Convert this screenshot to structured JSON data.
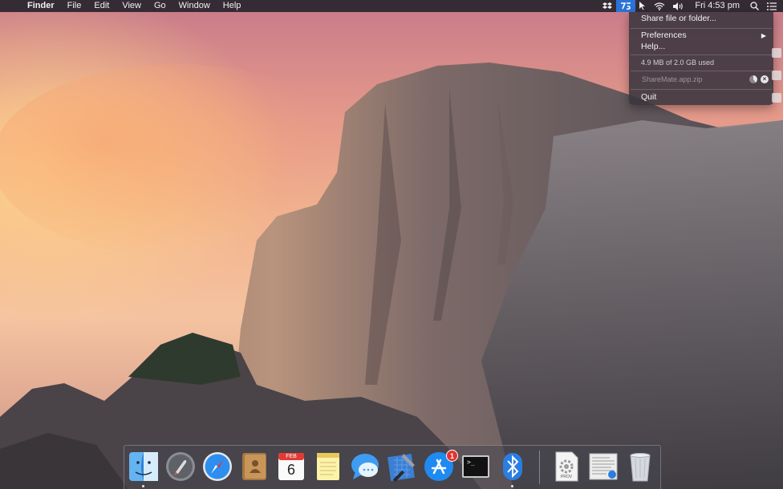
{
  "menubar": {
    "app_name": "Finder",
    "menus": [
      "File",
      "Edit",
      "View",
      "Go",
      "Window",
      "Help"
    ],
    "clock": "Fri 4:53 pm",
    "status_icons": [
      "dropbox-icon",
      "sharemate-icon",
      "cursor-icon",
      "wifi-icon",
      "volume-icon",
      "spotlight-icon",
      "notification-center-icon"
    ],
    "active_status_icon": "sharemate-icon"
  },
  "dropdown": {
    "share_label": "Share file or folder...",
    "preferences_label": "Preferences",
    "help_label": "Help...",
    "usage_text": "4.9 MB of 2.0 GB used",
    "upload_file": "ShareMate.app.zip",
    "quit_label": "Quit"
  },
  "dock": {
    "calendar_month": "FEB",
    "calendar_day": "6",
    "appstore_badge": "1",
    "terminal_prompt": ">_",
    "prov_label": "PROV",
    "items": [
      "Finder",
      "Launchpad",
      "Safari",
      "Contacts",
      "Calendar",
      "Notes",
      "Messages",
      "Xcode",
      "App Store",
      "Terminal",
      "Bluetooth File Exchange",
      "Provisioning Profile",
      "Document",
      "Trash"
    ]
  },
  "colors": {
    "menubar_bg": "#28242c",
    "selection_blue": "#2b73d8",
    "badge_red": "#e4342a"
  }
}
